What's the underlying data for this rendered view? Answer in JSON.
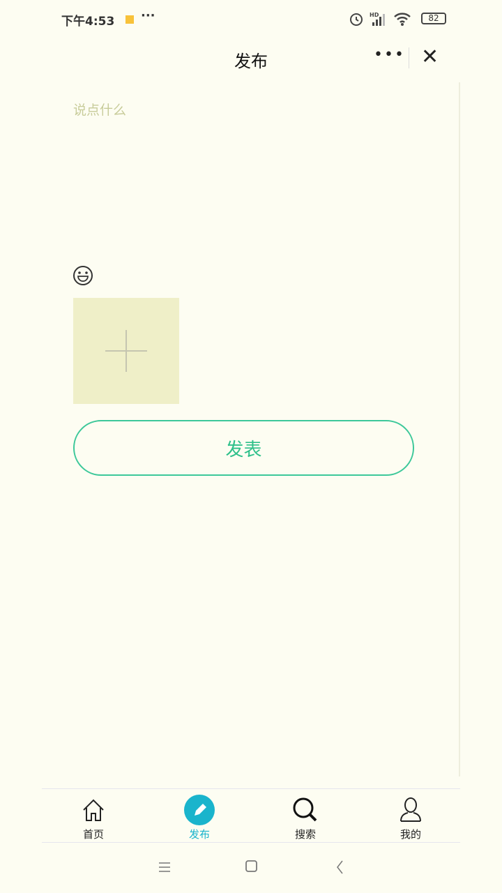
{
  "status_bar": {
    "time": "下午4:53",
    "battery": "82",
    "hd": "HD"
  },
  "header": {
    "title": "发布"
  },
  "editor": {
    "placeholder": "说点什么",
    "value": ""
  },
  "publish_button": "发表",
  "tabs": [
    {
      "label": "首页",
      "icon": "home-icon"
    },
    {
      "label": "发布",
      "icon": "pencil-icon",
      "active": true
    },
    {
      "label": "搜索",
      "icon": "search-icon"
    },
    {
      "label": "我的",
      "icon": "user-icon"
    }
  ],
  "colors": {
    "accent": "#1ab4cc",
    "button": "#3dc89a",
    "background": "#fdfdf2"
  }
}
